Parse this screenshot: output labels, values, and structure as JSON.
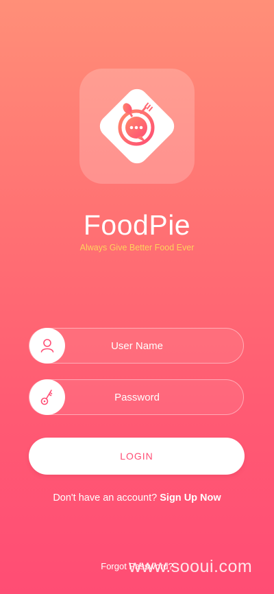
{
  "brand": {
    "name": "FoodPie",
    "tagline": "Always Give Better Food Ever",
    "logo_icon": "chat-bubble-with-spoon-fork-icon"
  },
  "form": {
    "username": {
      "placeholder": "User Name",
      "icon": "user-icon"
    },
    "password": {
      "placeholder": "Password",
      "icon": "key-icon"
    },
    "login_label": "LOGIN"
  },
  "signup": {
    "prompt": "Don't have an account?",
    "link": "Sign Up Now"
  },
  "forgot": {
    "label": "Forgot Password?"
  },
  "watermark": {
    "text": "www.sooui.com"
  },
  "colors": {
    "gradient_top": "#ff8f78",
    "gradient_bottom": "#ff4d74",
    "accent": "#ff4d74",
    "tagline": "#ffd35c"
  }
}
